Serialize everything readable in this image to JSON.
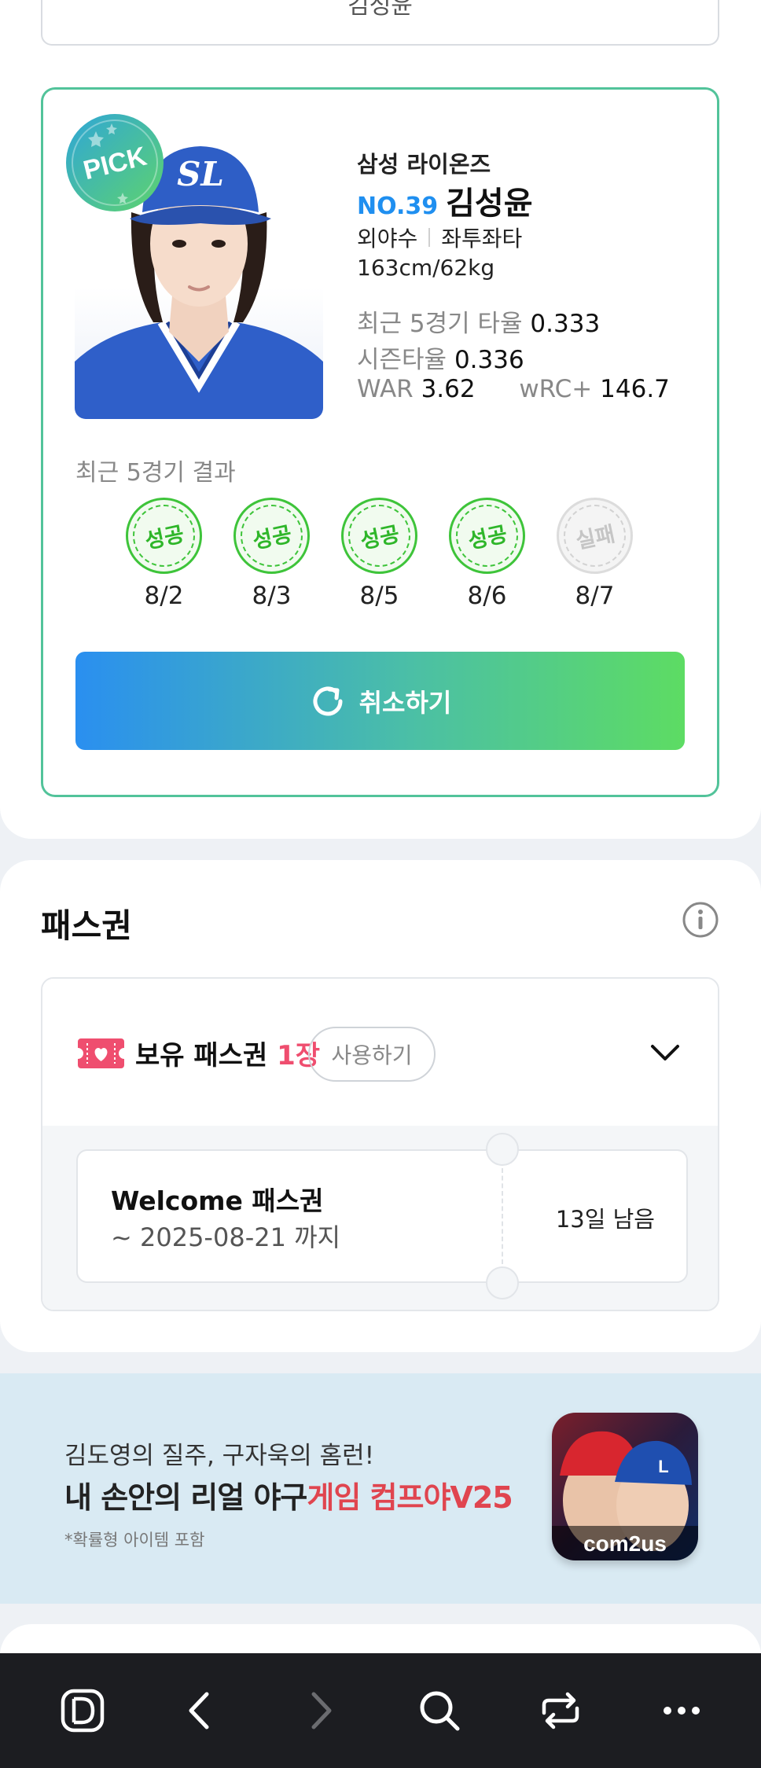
{
  "top_select": {
    "value": "김성윤"
  },
  "pick": {
    "badge": "PICK",
    "team": "삼성 라이온즈",
    "number": "NO.39",
    "name": "김성윤",
    "position": "외야수",
    "bats_throws": "좌투좌타",
    "body": "163cm/62kg",
    "recent5_avg_label": "최근 5경기 타율",
    "recent5_avg": "0.333",
    "season_avg_label": "시즌타율",
    "season_avg": "0.336",
    "war_label": "WAR",
    "war": "3.62",
    "wrc_label": "wRC+",
    "wrc": "146.7",
    "recent_title": "최근 5경기 결과",
    "results": [
      {
        "status": "성공",
        "date": "8/2",
        "ok": true
      },
      {
        "status": "성공",
        "date": "8/3",
        "ok": true
      },
      {
        "status": "성공",
        "date": "8/5",
        "ok": true
      },
      {
        "status": "성공",
        "date": "8/6",
        "ok": true
      },
      {
        "status": "실패",
        "date": "8/7",
        "ok": false
      }
    ],
    "cancel_label": "취소하기",
    "colors": {
      "success": "#3ec43a",
      "number": "#1f8ff0",
      "btn_from": "#2a8ff0",
      "btn_to": "#5ddc63"
    }
  },
  "pass": {
    "title": "패스권",
    "owned_label": "보유 패스권",
    "owned_count": "1장",
    "use_label": "사용하기",
    "ticket": {
      "name": "Welcome 패스권",
      "until": "~ 2025-08-21 까지",
      "remaining": "13일 남음"
    },
    "accent": "#ef4e6f"
  },
  "banner": {
    "line1": "김도영의 질주, 구자욱의 홈런!",
    "line2_prefix": "내 손안의 리얼 야구",
    "line2_highlight": "게임 컴프야V25",
    "line3": "*확률형 아이템 포함",
    "game_logo": "com2us"
  },
  "bottom_nav": {
    "icons": [
      "d-logo-icon",
      "back-icon",
      "forward-icon",
      "search-icon",
      "tabs-icon",
      "more-icon"
    ]
  }
}
